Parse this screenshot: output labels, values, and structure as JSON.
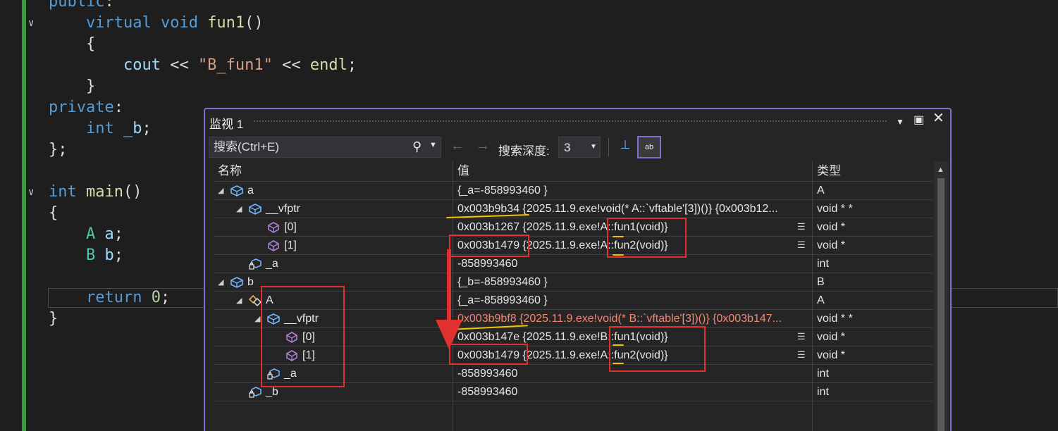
{
  "code": {
    "lines": [
      {
        "parts": [
          {
            "t": "kw",
            "v": "public"
          },
          {
            "t": "plain",
            "v": ":"
          }
        ]
      },
      {
        "parts": [
          {
            "t": "plain",
            "v": "    "
          },
          {
            "t": "kw",
            "v": "virtual"
          },
          {
            "t": "plain",
            "v": " "
          },
          {
            "t": "kw",
            "v": "void"
          },
          {
            "t": "plain",
            "v": " "
          },
          {
            "t": "fn",
            "v": "fun1"
          },
          {
            "t": "plain",
            "v": "()"
          }
        ]
      },
      {
        "parts": [
          {
            "t": "plain",
            "v": "    {"
          }
        ]
      },
      {
        "parts": [
          {
            "t": "plain",
            "v": "        "
          },
          {
            "t": "var",
            "v": "cout"
          },
          {
            "t": "plain",
            "v": " << "
          },
          {
            "t": "str",
            "v": "\"B_fun1\""
          },
          {
            "t": "plain",
            "v": " << "
          },
          {
            "t": "fn",
            "v": "endl"
          },
          {
            "t": "plain",
            "v": ";"
          }
        ]
      },
      {
        "parts": [
          {
            "t": "plain",
            "v": "    }"
          }
        ]
      },
      {
        "parts": [
          {
            "t": "kw",
            "v": "private"
          },
          {
            "t": "plain",
            "v": ":"
          }
        ]
      },
      {
        "parts": [
          {
            "t": "plain",
            "v": "    "
          },
          {
            "t": "kw",
            "v": "int"
          },
          {
            "t": "plain",
            "v": " "
          },
          {
            "t": "var",
            "v": "_b"
          },
          {
            "t": "plain",
            "v": ";"
          }
        ]
      },
      {
        "parts": [
          {
            "t": "plain",
            "v": "};"
          }
        ]
      },
      {
        "parts": []
      },
      {
        "parts": [
          {
            "t": "kw",
            "v": "int"
          },
          {
            "t": "plain",
            "v": " "
          },
          {
            "t": "fn",
            "v": "main"
          },
          {
            "t": "plain",
            "v": "()"
          }
        ]
      },
      {
        "parts": [
          {
            "t": "plain",
            "v": "{"
          }
        ]
      },
      {
        "parts": [
          {
            "t": "plain",
            "v": "    "
          },
          {
            "t": "cls",
            "v": "A"
          },
          {
            "t": "plain",
            "v": " "
          },
          {
            "t": "var",
            "v": "a"
          },
          {
            "t": "plain",
            "v": ";"
          }
        ]
      },
      {
        "parts": [
          {
            "t": "plain",
            "v": "    "
          },
          {
            "t": "cls",
            "v": "B"
          },
          {
            "t": "plain",
            "v": " "
          },
          {
            "t": "var",
            "v": "b"
          },
          {
            "t": "plain",
            "v": ";"
          }
        ]
      },
      {
        "parts": []
      },
      {
        "parts": [
          {
            "t": "plain",
            "v": "    "
          },
          {
            "t": "kw",
            "v": "return"
          },
          {
            "t": "plain",
            "v": " "
          },
          {
            "t": "num",
            "v": "0"
          },
          {
            "t": "plain",
            "v": ";"
          }
        ]
      },
      {
        "parts": [
          {
            "t": "plain",
            "v": "}"
          }
        ]
      }
    ]
  },
  "watch": {
    "title": "监视 1",
    "search_placeholder": "搜索(Ctrl+E)",
    "depth_label": "搜索深度:",
    "depth_value": "3",
    "columns": {
      "name": "名称",
      "value": "值",
      "type": "类型"
    },
    "rows": [
      {
        "level": 0,
        "expander": "expanded",
        "icon": "object",
        "name": "a",
        "value": "{_a=-858993460 }",
        "type": "A",
        "viz": false,
        "changed": false
      },
      {
        "level": 1,
        "expander": "expanded",
        "icon": "object",
        "name": "__vfptr",
        "value": "0x003b9b34 {2025.11.9.exe!void(* A::`vftable'[3])()} {0x003b12...",
        "type": "void * *",
        "viz": false,
        "changed": false
      },
      {
        "level": 2,
        "expander": "none",
        "icon": "element",
        "name": "[0]",
        "value": "0x003b1267 {2025.11.9.exe!A::fun1(void)}",
        "type": "void *",
        "viz": true,
        "changed": false
      },
      {
        "level": 2,
        "expander": "none",
        "icon": "element",
        "name": "[1]",
        "value": "0x003b1479 {2025.11.9.exe!A::fun2(void)}",
        "type": "void *",
        "viz": true,
        "changed": false
      },
      {
        "level": 1,
        "expander": "none",
        "icon": "private-field",
        "name": "_a",
        "value": "-858993460",
        "type": "int",
        "viz": false,
        "changed": false
      },
      {
        "level": 0,
        "expander": "expanded",
        "icon": "object",
        "name": "b",
        "value": "{_b=-858993460 }",
        "type": "B",
        "viz": false,
        "changed": false
      },
      {
        "level": 1,
        "expander": "expanded",
        "icon": "base-class",
        "name": "A",
        "value": "{_a=-858993460 }",
        "type": "A",
        "viz": false,
        "changed": false
      },
      {
        "level": 2,
        "expander": "expanded",
        "icon": "object",
        "name": "__vfptr",
        "value": "0x003b9bf8 {2025.11.9.exe!void(* B::`vftable'[3])()} {0x003b147...",
        "type": "void * *",
        "viz": false,
        "changed": true
      },
      {
        "level": 3,
        "expander": "none",
        "icon": "element",
        "name": "[0]",
        "value": "0x003b147e {2025.11.9.exe!B::fun1(void)}",
        "type": "void *",
        "viz": true,
        "changed": false
      },
      {
        "level": 3,
        "expander": "none",
        "icon": "element",
        "name": "[1]",
        "value": "0x003b1479 {2025.11.9.exe!A::fun2(void)}",
        "type": "void *",
        "viz": true,
        "changed": false
      },
      {
        "level": 2,
        "expander": "none",
        "icon": "private-field",
        "name": "_a",
        "value": "-858993460",
        "type": "int",
        "viz": false,
        "changed": false
      },
      {
        "level": 1,
        "expander": "none",
        "icon": "private-field",
        "name": "_b",
        "value": "-858993460",
        "type": "int",
        "viz": false,
        "changed": false
      },
      {
        "level": 0,
        "expander": "none",
        "icon": "none",
        "name": "",
        "value": "",
        "type": "",
        "viz": false,
        "changed": false
      }
    ]
  },
  "colors": {
    "accent": "#8a6bd6",
    "annotation_red": "#e03030",
    "annotation_yellow": "#f2c200",
    "changed_value": "#f48771"
  }
}
